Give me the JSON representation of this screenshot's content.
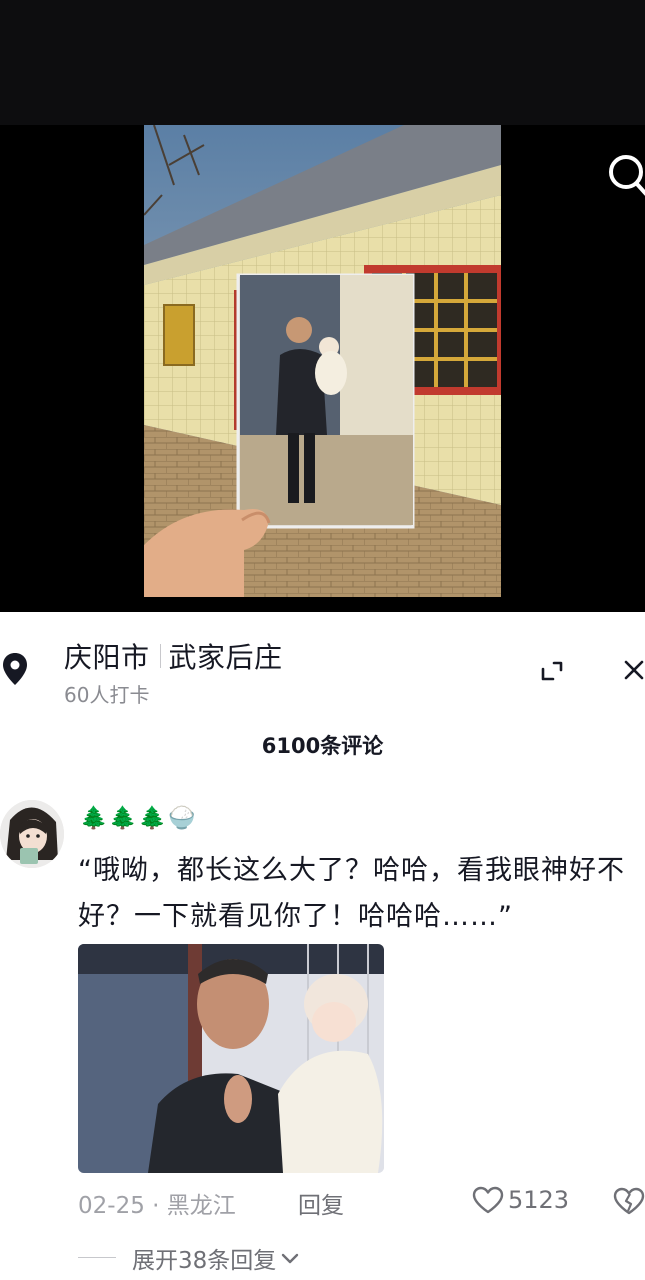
{
  "location": {
    "city": "庆阳市",
    "place": "武家后庄",
    "checkins": "60人打卡"
  },
  "comments_header": {
    "count_label": "6100条评论"
  },
  "comment": {
    "username": "🌲🌲🌲🍚",
    "text": "“哦呦，都长这么大了？哈哈，看我眼神好不好？一下就看见你了！哈哈哈……”",
    "date": "02-25",
    "region": "黑龙江",
    "reply_label": "回复",
    "likes": "5123",
    "expand_label": "展开38条回复"
  },
  "icons": {
    "search": "search-icon",
    "pin": "location-pin-icon",
    "collapse": "collapse-icon",
    "close": "close-icon",
    "like": "heart-icon",
    "dislike": "broken-heart-icon",
    "expand": "chevron-down-icon"
  },
  "colors": {
    "username": "#35b07a",
    "secondary_text": "#8a8b91",
    "primary_text": "#161823"
  }
}
